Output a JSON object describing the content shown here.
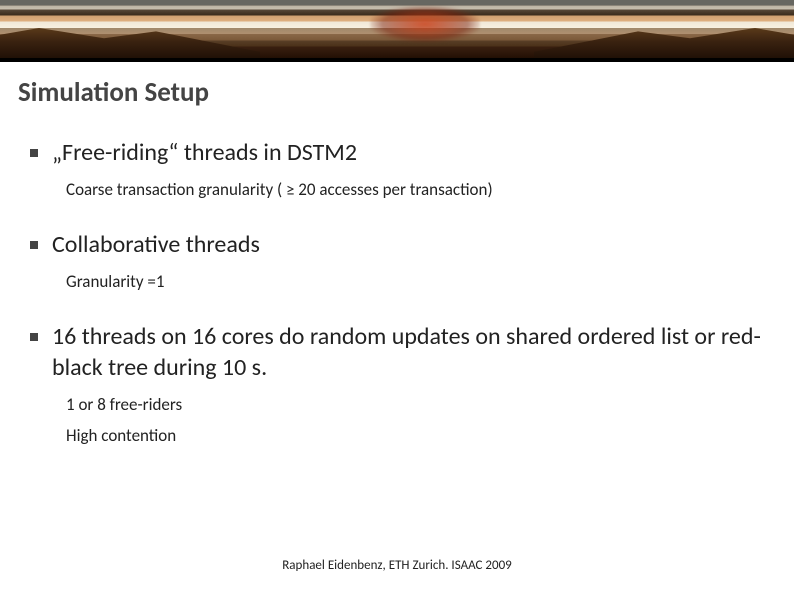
{
  "title": "Simulation Setup",
  "items": [
    {
      "head": "„Free-riding“ threads in DSTM2",
      "subs": [
        "Coarse transaction granularity ( ≥ 20 accesses per transaction)"
      ]
    },
    {
      "head": "Collaborative threads",
      "subs": [
        "Granularity =1"
      ]
    },
    {
      "head": "16 threads on 16 cores do random updates on shared ordered list or red-black tree during 10 s.",
      "subs": [
        "1 or 8 free-riders",
        "High contention"
      ]
    }
  ],
  "footer": "Raphael Eidenbenz, ETH Zurich. ISAAC 2009"
}
